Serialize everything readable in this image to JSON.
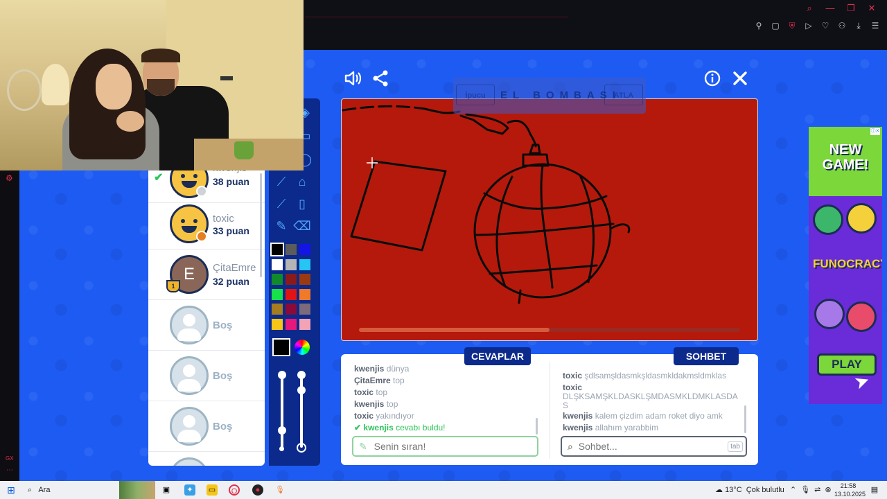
{
  "browser": {
    "window_controls": [
      "search-icon",
      "minimize-icon",
      "restore-icon",
      "close-icon"
    ],
    "toolbar_icons": [
      "pin-icon",
      "snapshot-icon",
      "shield-icon",
      "play-icon",
      "heart-icon",
      "account-icon",
      "download-icon",
      "menu-icon"
    ],
    "sidebar_label": "GX"
  },
  "game": {
    "top_icons": [
      "speaker-icon",
      "share-icon",
      "info-icon",
      "close-icon"
    ],
    "hint": {
      "left_button": "İpucu",
      "word": "EL BOMBASI",
      "right_button": "ATLA"
    },
    "timer_fraction": 0.5
  },
  "players": [
    {
      "name": "kwenjis",
      "score": "38 puan",
      "avatar": "smile",
      "status_color": "#cfd3d8",
      "guessed": true
    },
    {
      "name": "toxic",
      "score": "33 puan",
      "avatar": "smile",
      "status_color": "#e67e22",
      "guessed": false
    },
    {
      "name": "ÇitaEmre",
      "score": "32 puan",
      "avatar": "letter",
      "avatar_letter": "E",
      "trophy": "1"
    },
    {
      "name": "Boş",
      "avatar": "empty"
    },
    {
      "name": "Boş",
      "avatar": "empty"
    },
    {
      "name": "Boş",
      "avatar": "empty"
    }
  ],
  "palette": [
    "#000000",
    "#5c5c5c",
    "#1414e6",
    "#ffffff",
    "#b5b5b5",
    "#27c5f2",
    "#118a2b",
    "#8b1a1a",
    "#9b3a12",
    "#16e04a",
    "#e01414",
    "#f07a2a",
    "#a67c20",
    "#8a0a3a",
    "#7d6a7a",
    "#f5c518",
    "#e8187a",
    "#f2a3b5"
  ],
  "current_color": "#000000",
  "answers": {
    "title": "CEVAPLAR",
    "messages": [
      {
        "user": "kwenjis",
        "text": "dünya"
      },
      {
        "user": "ÇitaEmre",
        "text": "top"
      },
      {
        "user": "toxic",
        "text": "top"
      },
      {
        "user": "kwenjis",
        "text": "top"
      },
      {
        "user": "toxic",
        "text": "yakındıyor"
      }
    ],
    "found": {
      "user": "kwenjis",
      "text": "cevabı buldu!"
    },
    "placeholder": "Senin sıran!"
  },
  "chat": {
    "title": "SOHBET",
    "messages": [
      {
        "user": "toxic",
        "text": "şdlsamşldasmkşldasmkldakmsldmklas"
      },
      {
        "user": "toxic",
        "text": "DLŞKSAMŞKLDASKLŞMDASMKLDMKLASDAS"
      },
      {
        "user": "kwenjis",
        "text": "kalem çizdim adam roket diyo amk"
      },
      {
        "user": "kwenjis",
        "text": "allahım yarabbim"
      }
    ],
    "placeholder": "Sohbet...",
    "tab_hint": "tab"
  },
  "ad": {
    "headline": "NEW GAME!",
    "brand": "FUNOCRACY",
    "cta": "PLAY"
  },
  "taskbar": {
    "search_label": "Ara",
    "weather": "13°C",
    "weather_text": "Çok bulutlu",
    "time": "21:58",
    "date": "13.10.2025"
  }
}
